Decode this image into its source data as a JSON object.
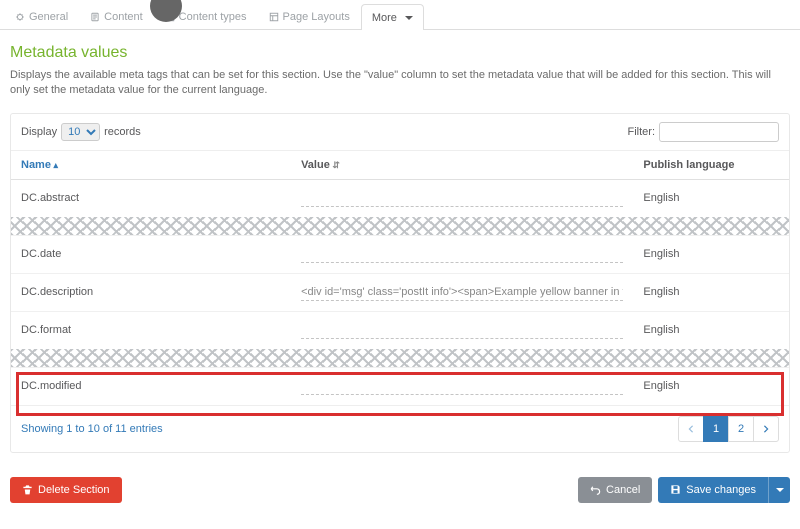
{
  "tabs": {
    "general": "General",
    "content": "Content",
    "content_types": "Content types",
    "page_layouts": "Page Layouts",
    "more": "More"
  },
  "page": {
    "title": "Metadata values",
    "description": "Displays the available meta tags that can be set for this section. Use the \"value\" column to set the metadata value that will be added for this section. This will only set the metadata value for the current language."
  },
  "controls": {
    "display_label": "Display",
    "display_value": "10",
    "records_label": "records",
    "filter_label": "Filter:",
    "filter_value": ""
  },
  "columns": {
    "name": "Name",
    "value": "Value",
    "lang": "Publish language"
  },
  "rows": {
    "abstract": {
      "name": "DC.abstract",
      "value": "",
      "lang": "English"
    },
    "date": {
      "name": "DC.date",
      "value": "",
      "lang": "English"
    },
    "description": {
      "name": "DC.description",
      "value": "<div id='msg' class='postIt info'><span>Example yellow banner in the D",
      "lang": "English"
    },
    "format": {
      "name": "DC.format",
      "value": "",
      "lang": "English"
    },
    "modified": {
      "name": "DC.modified",
      "value": "",
      "lang": "English"
    }
  },
  "footer": {
    "showing": "Showing 1 to 10 of 11 entries",
    "pages": {
      "p1": "1",
      "p2": "2"
    }
  },
  "buttons": {
    "delete": "Delete Section",
    "cancel": "Cancel",
    "save": "Save changes"
  }
}
